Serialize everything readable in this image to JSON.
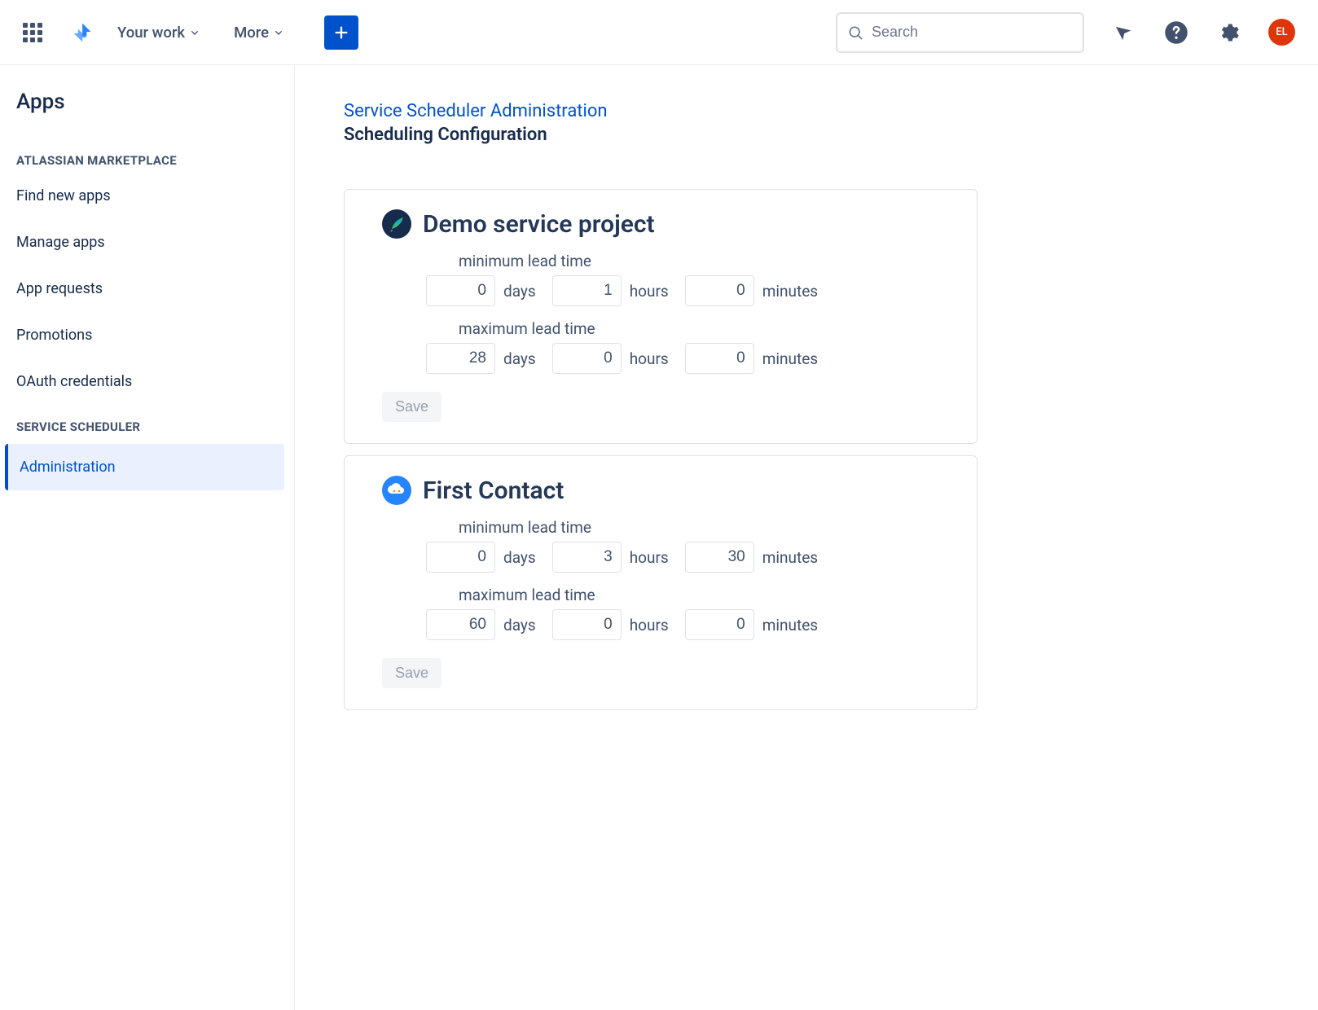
{
  "header": {
    "nav": {
      "your_work": "Your work",
      "more": "More"
    },
    "search_placeholder": "Search",
    "avatar": "EL"
  },
  "sidebar": {
    "title": "Apps",
    "sections": [
      {
        "label": "ATLASSIAN MARKETPLACE",
        "items": [
          {
            "label": "Find new apps",
            "active": false
          },
          {
            "label": "Manage apps",
            "active": false
          },
          {
            "label": "App requests",
            "active": false
          },
          {
            "label": "Promotions",
            "active": false
          },
          {
            "label": "OAuth credentials",
            "active": false
          }
        ]
      },
      {
        "label": "SERVICE SCHEDULER",
        "items": [
          {
            "label": "Administration",
            "active": true
          }
        ]
      }
    ]
  },
  "main": {
    "breadcrumb": "Service Scheduler Administration",
    "title": "Scheduling Configuration",
    "labels": {
      "min_lead": "minimum lead time",
      "max_lead": "maximum lead time",
      "days": "days",
      "hours": "hours",
      "minutes": "minutes",
      "save": "Save"
    },
    "projects": [
      {
        "name": "Demo service project",
        "icon": "rocket",
        "min": {
          "days": "0",
          "hours": "1",
          "minutes": "0"
        },
        "max": {
          "days": "28",
          "hours": "0",
          "minutes": "0"
        }
      },
      {
        "name": "First Contact",
        "icon": "cloud",
        "min": {
          "days": "0",
          "hours": "3",
          "minutes": "30"
        },
        "max": {
          "days": "60",
          "hours": "0",
          "minutes": "0"
        }
      }
    ]
  }
}
